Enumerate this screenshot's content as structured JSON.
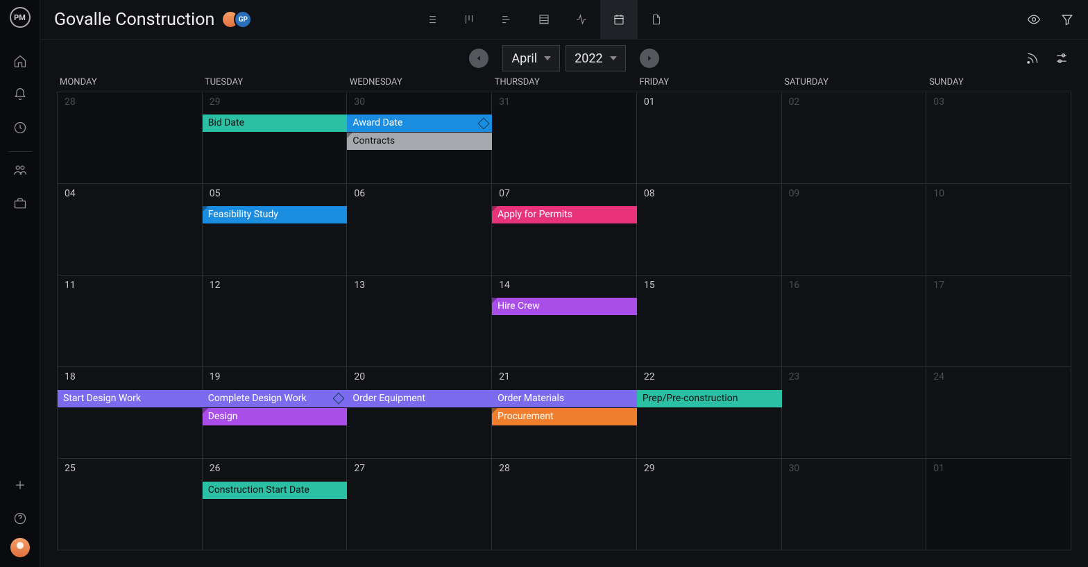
{
  "project_title": "Govalle Construction",
  "avatars": {
    "a2_label": "GP"
  },
  "calendar": {
    "month": "April",
    "year": "2022",
    "weekdays": [
      "MONDAY",
      "TUESDAY",
      "WEDNESDAY",
      "THURSDAY",
      "FRIDAY",
      "SATURDAY",
      "SUNDAY"
    ],
    "cells": [
      {
        "n": "28",
        "other": true
      },
      {
        "n": "29",
        "other": true
      },
      {
        "n": "30",
        "other": true
      },
      {
        "n": "31",
        "other": true
      },
      {
        "n": "01"
      },
      {
        "n": "02",
        "weekend": true
      },
      {
        "n": "03",
        "weekend": true
      },
      {
        "n": "04"
      },
      {
        "n": "05"
      },
      {
        "n": "06"
      },
      {
        "n": "07"
      },
      {
        "n": "08"
      },
      {
        "n": "09",
        "weekend": true
      },
      {
        "n": "10",
        "weekend": true
      },
      {
        "n": "11"
      },
      {
        "n": "12"
      },
      {
        "n": "13"
      },
      {
        "n": "14"
      },
      {
        "n": "15"
      },
      {
        "n": "16",
        "weekend": true
      },
      {
        "n": "17",
        "weekend": true
      },
      {
        "n": "18"
      },
      {
        "n": "19"
      },
      {
        "n": "20"
      },
      {
        "n": "21"
      },
      {
        "n": "22"
      },
      {
        "n": "23",
        "weekend": true
      },
      {
        "n": "24",
        "weekend": true
      },
      {
        "n": "25"
      },
      {
        "n": "26"
      },
      {
        "n": "27"
      },
      {
        "n": "28"
      },
      {
        "n": "29"
      },
      {
        "n": "30",
        "weekend": true
      },
      {
        "n": "01",
        "other": true
      }
    ],
    "events": [
      {
        "label": "Bid Date",
        "color": "c-teal",
        "row": 0,
        "lane": 0,
        "colStart": 1,
        "colSpan": 1,
        "darkText": true
      },
      {
        "label": "Award Date",
        "color": "c-blue",
        "row": 0,
        "lane": 0,
        "colStart": 2,
        "colSpan": 1,
        "milestone": true
      },
      {
        "label": "Contracts",
        "color": "c-grey",
        "row": 0,
        "lane": 1,
        "colStart": 2,
        "colSpan": 1,
        "corner": true,
        "darkText": true
      },
      {
        "label": "Feasibility Study",
        "color": "c-blue",
        "row": 1,
        "lane": 0,
        "colStart": 1,
        "colSpan": 1,
        "corner": true
      },
      {
        "label": "Apply for Permits",
        "color": "c-pink",
        "row": 1,
        "lane": 0,
        "colStart": 3,
        "colSpan": 1,
        "corner": true
      },
      {
        "label": "Hire Crew",
        "color": "c-purple",
        "row": 2,
        "lane": 0,
        "colStart": 3,
        "colSpan": 1,
        "corner": true
      },
      {
        "label": "Start Design Work",
        "color": "c-violet",
        "row": 3,
        "lane": 0,
        "colStart": 0,
        "colSpan": 1
      },
      {
        "label": "Complete Design Work",
        "color": "c-violet",
        "row": 3,
        "lane": 0,
        "colStart": 1,
        "colSpan": 1,
        "milestone": true
      },
      {
        "label": "Order Equipment",
        "color": "c-violet",
        "row": 3,
        "lane": 0,
        "colStart": 2,
        "colSpan": 1
      },
      {
        "label": "Order Materials",
        "color": "c-violet",
        "row": 3,
        "lane": 0,
        "colStart": 3,
        "colSpan": 1
      },
      {
        "label": "Prep/Pre-construction",
        "color": "c-teal",
        "row": 3,
        "lane": 0,
        "colStart": 4,
        "colSpan": 1,
        "darkText": true
      },
      {
        "label": "Design",
        "color": "c-purple",
        "row": 3,
        "lane": 1,
        "colStart": 1,
        "colSpan": 1,
        "corner": true
      },
      {
        "label": "Procurement",
        "color": "c-orange",
        "row": 3,
        "lane": 1,
        "colStart": 3,
        "colSpan": 1,
        "corner": true
      },
      {
        "label": "Construction Start Date",
        "color": "c-teal",
        "row": 4,
        "lane": 0,
        "colStart": 1,
        "colSpan": 1,
        "darkText": true
      }
    ]
  }
}
